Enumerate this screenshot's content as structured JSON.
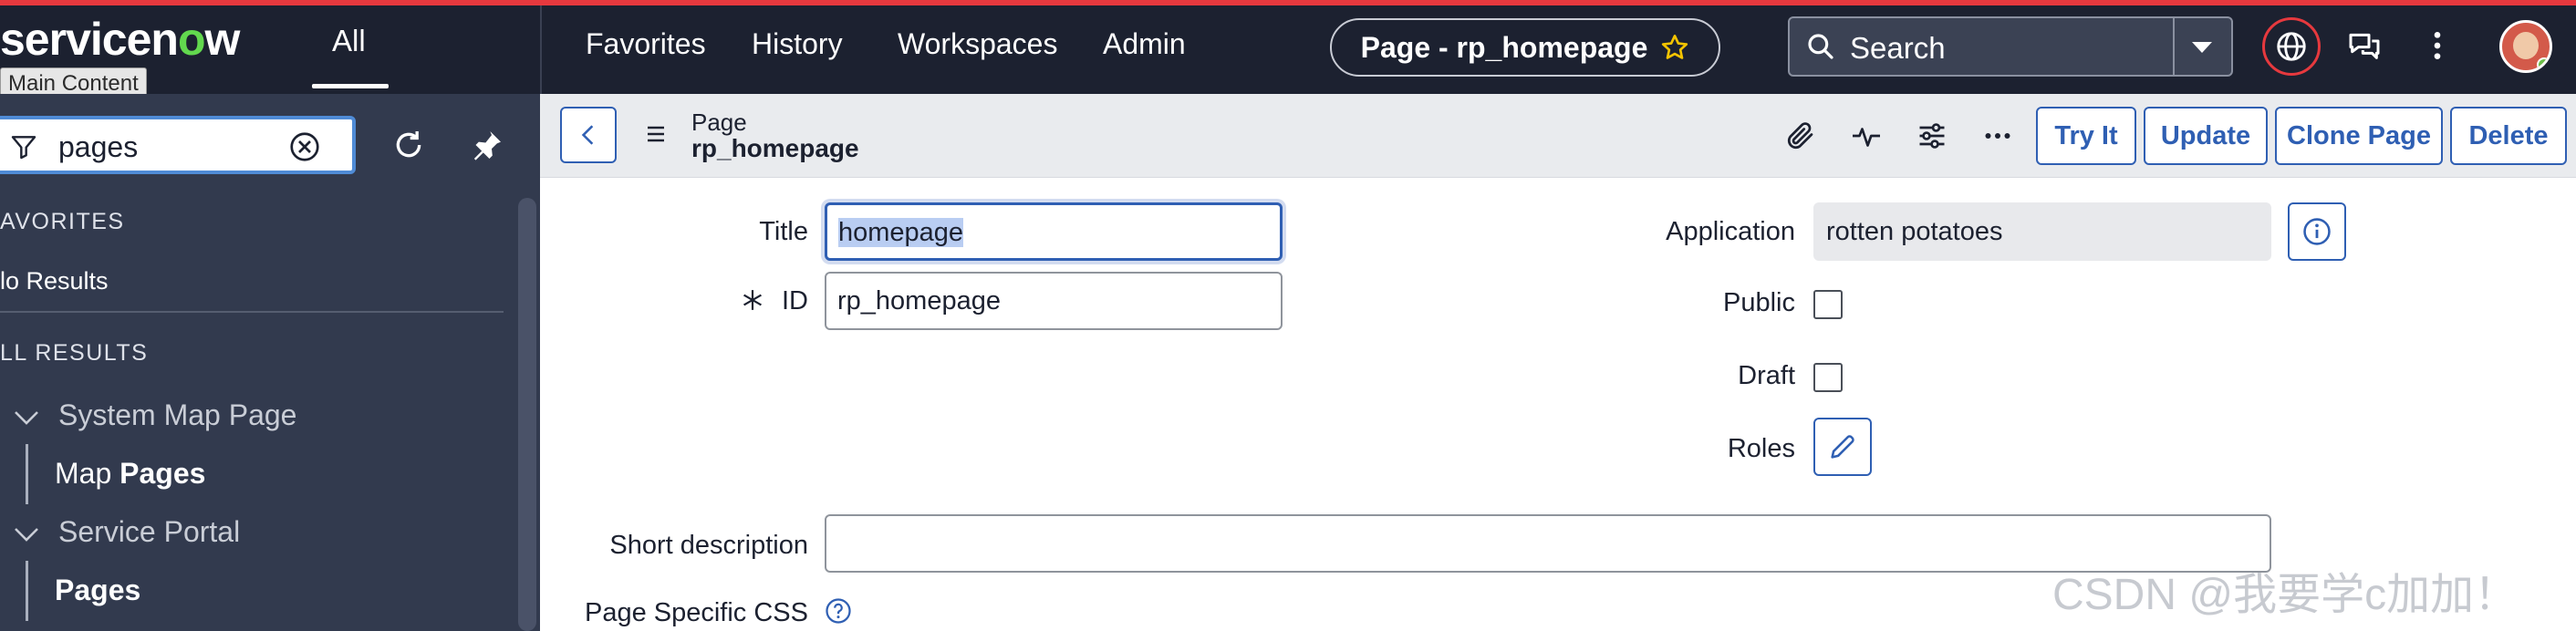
{
  "header": {
    "logo_text_1": "servicen",
    "logo_text_o": "o",
    "logo_text_2": "w",
    "all_tab": "All",
    "tooltip": "Main Content",
    "nav": [
      "Favorites",
      "History",
      "Workspaces",
      "Admin"
    ],
    "page_pill": "Page - rp_homepage",
    "search_label": "Search",
    "accent_color": "#e6393e"
  },
  "sidebar": {
    "filter_value": "pages",
    "favorites_heading": "AVORITES",
    "no_results": "lo Results",
    "all_results_heading": "LL RESULTS",
    "group1": "System Map Page",
    "item1_prefix": "Map ",
    "item1_bold": "Pages",
    "group2": "Service Portal",
    "item2_bold": "Pages"
  },
  "form_header": {
    "record_type": "Page",
    "record_name": "rp_homepage",
    "buttons": [
      "Try It",
      "Update",
      "Clone Page",
      "Delete"
    ]
  },
  "form": {
    "title_label": "Title",
    "title_value": "homepage",
    "id_label": "ID",
    "id_value": "rp_homepage",
    "application_label": "Application",
    "application_value": "rotten potatoes",
    "public_label": "Public",
    "public_checked": false,
    "draft_label": "Draft",
    "draft_checked": false,
    "roles_label": "Roles",
    "short_description_label": "Short description",
    "short_description_value": "",
    "page_css_label": "Page Specific CSS"
  },
  "watermark": "CSDN @我要学c加加！"
}
